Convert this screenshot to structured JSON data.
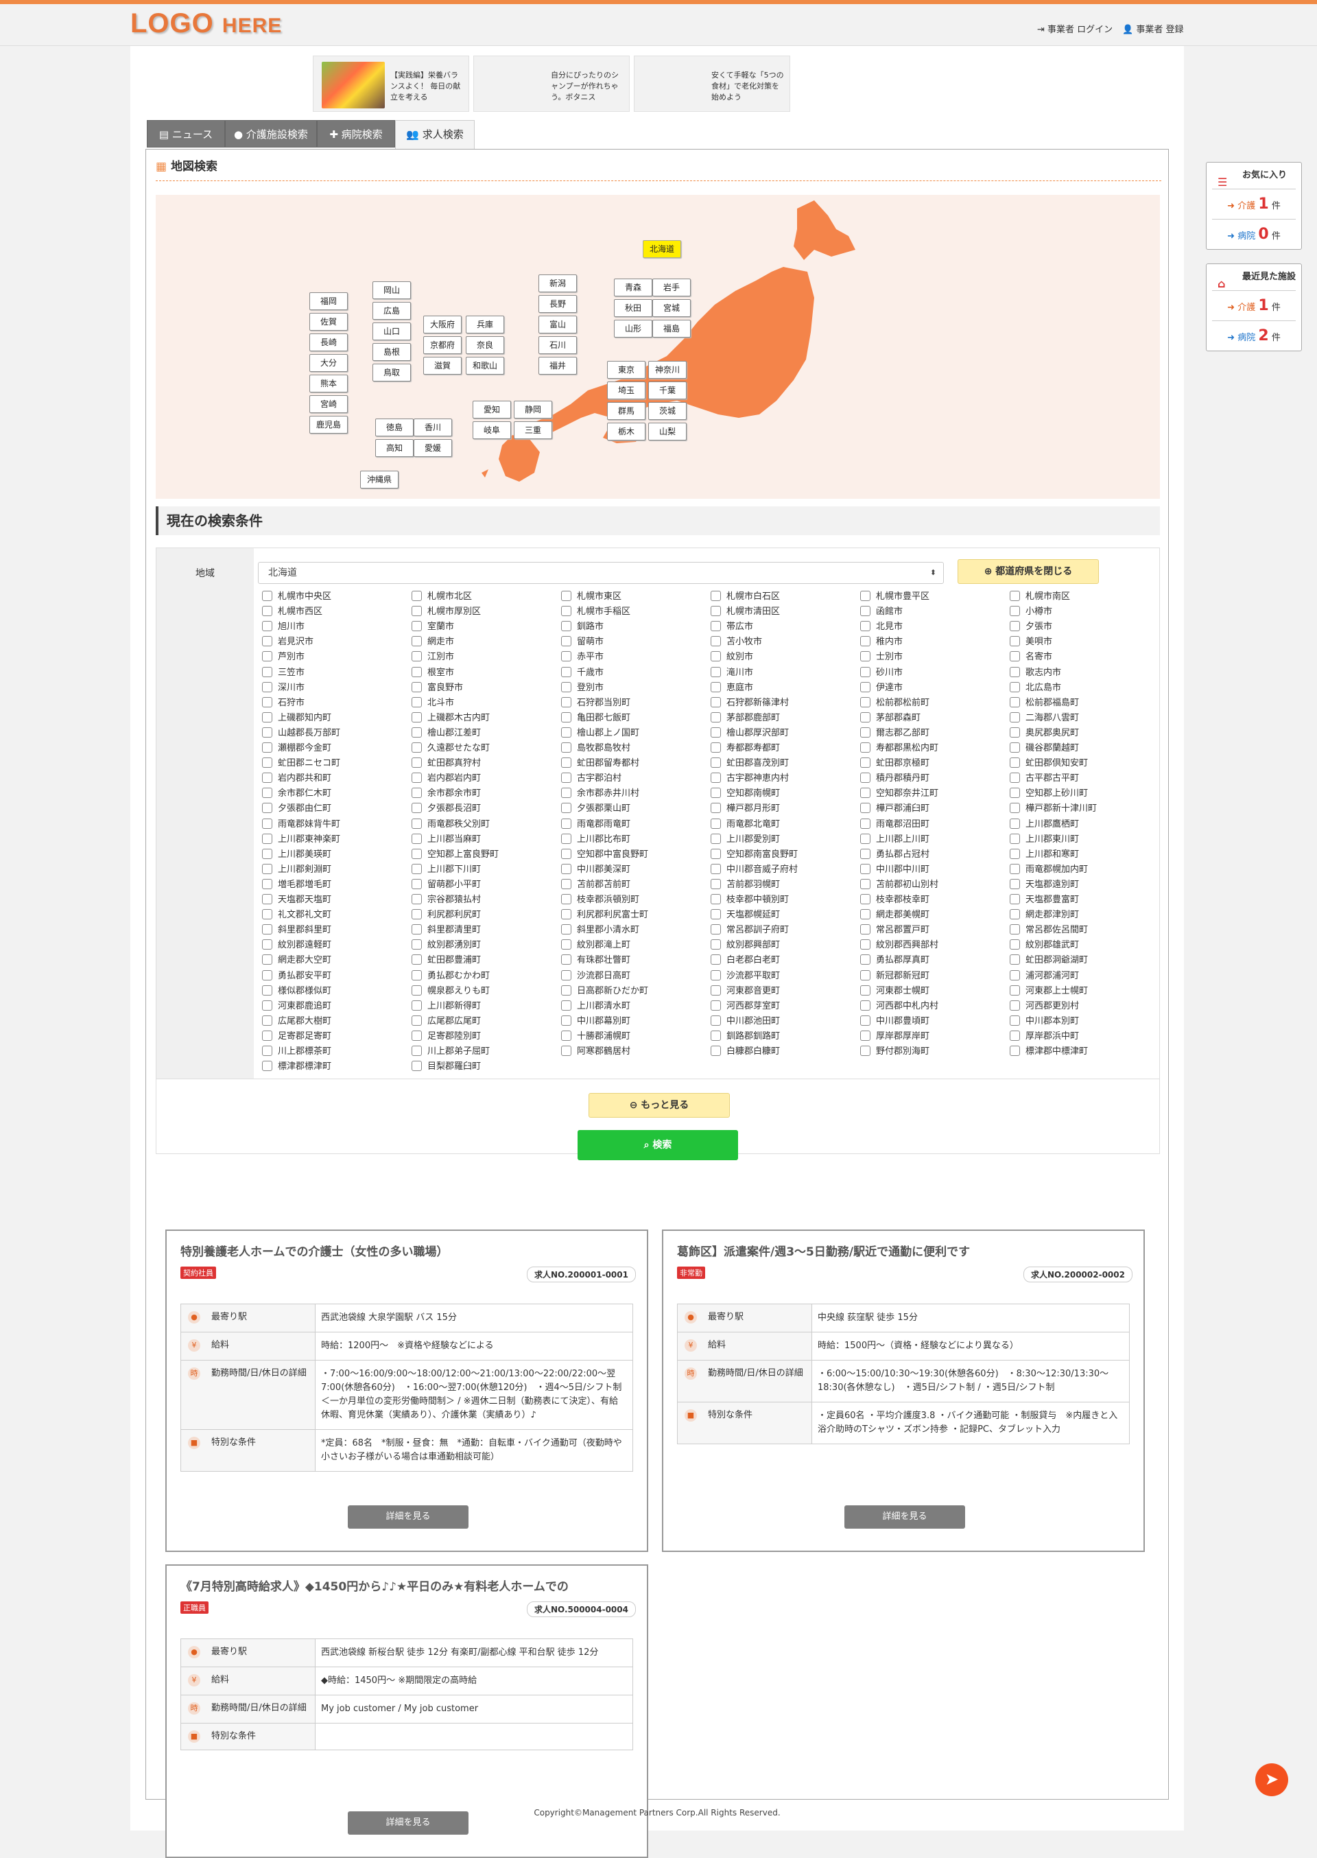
{
  "header": {
    "logo_main": "LOGO",
    "logo_sub": "HERE",
    "login": "事業者 ログイン",
    "register": "事業者 登録"
  },
  "ads": [
    {
      "text": "【実践編】栄養バランスよく！ 毎日の献立を考える"
    },
    {
      "text": "自分にぴったりのシャンプーが作れちゃう。ボタニス"
    },
    {
      "text": "安くて手軽な「5つの食材」で老化対策を始めよう"
    }
  ],
  "tabs": [
    {
      "label": "ニュース"
    },
    {
      "label": "介護施設検索"
    },
    {
      "label": "病院検索"
    },
    {
      "label": "求人検索"
    }
  ],
  "map": {
    "heading": "地図検索",
    "prefs": [
      "北海道",
      "青森",
      "岩手",
      "秋田",
      "宮城",
      "山形",
      "福島",
      "新潟",
      "長野",
      "富山",
      "石川",
      "福井",
      "東京",
      "神奈川",
      "埼玉",
      "千葉",
      "群馬",
      "茨城",
      "栃木",
      "山梨",
      "愛知",
      "静岡",
      "岐阜",
      "三重",
      "大阪府",
      "兵庫",
      "京都府",
      "奈良",
      "滋賀",
      "和歌山",
      "岡山",
      "広島",
      "山口",
      "島根",
      "鳥取",
      "徳島",
      "香川",
      "高知",
      "愛媛",
      "福岡",
      "佐賀",
      "長崎",
      "大分",
      "熊本",
      "宮崎",
      "鹿児島",
      "沖縄県"
    ]
  },
  "conditions": {
    "heading": "現在の検索条件",
    "area_label": "地域",
    "selected": "北海道",
    "close_btn": "都道府県を閉じる",
    "more_btn": "もっと見る",
    "search_btn": "検索",
    "cities": [
      "札幌市中央区",
      "札幌市北区",
      "札幌市東区",
      "札幌市白石区",
      "札幌市豊平区",
      "札幌市南区",
      "札幌市西区",
      "札幌市厚別区",
      "札幌市手稲区",
      "札幌市清田区",
      "函館市",
      "小樽市",
      "旭川市",
      "室蘭市",
      "釧路市",
      "帯広市",
      "北見市",
      "夕張市",
      "岩見沢市",
      "網走市",
      "留萌市",
      "苫小牧市",
      "稚内市",
      "美唄市",
      "芦別市",
      "江別市",
      "赤平市",
      "紋別市",
      "士別市",
      "名寄市",
      "三笠市",
      "根室市",
      "千歳市",
      "滝川市",
      "砂川市",
      "歌志内市",
      "深川市",
      "富良野市",
      "登別市",
      "恵庭市",
      "伊達市",
      "北広島市",
      "石狩市",
      "北斗市",
      "石狩郡当別町",
      "石狩郡新篠津村",
      "松前郡松前町",
      "松前郡福島町",
      "上磯郡知内町",
      "上磯郡木古内町",
      "亀田郡七飯町",
      "茅部郡鹿部町",
      "茅部郡森町",
      "二海郡八雲町",
      "山越郡長万部町",
      "檜山郡江差町",
      "檜山郡上ノ国町",
      "檜山郡厚沢部町",
      "爾志郡乙部町",
      "奥尻郡奥尻町",
      "瀬棚郡今金町",
      "久遠郡せたな町",
      "島牧郡島牧村",
      "寿都郡寿都町",
      "寿都郡黒松内町",
      "磯谷郡蘭越町",
      "虻田郡ニセコ町",
      "虻田郡真狩村",
      "虻田郡留寿都村",
      "虻田郡喜茂別町",
      "虻田郡京極町",
      "虻田郡倶知安町",
      "岩内郡共和町",
      "岩内郡岩内町",
      "古宇郡泊村",
      "古宇郡神恵内村",
      "積丹郡積丹町",
      "古平郡古平町",
      "余市郡仁木町",
      "余市郡余市町",
      "余市郡赤井川村",
      "空知郡南幌町",
      "空知郡奈井江町",
      "空知郡上砂川町",
      "夕張郡由仁町",
      "夕張郡長沼町",
      "夕張郡栗山町",
      "樺戸郡月形町",
      "樺戸郡浦臼町",
      "樺戸郡新十津川町",
      "雨竜郡妹背牛町",
      "雨竜郡秩父別町",
      "雨竜郡雨竜町",
      "雨竜郡北竜町",
      "雨竜郡沼田町",
      "上川郡鷹栖町",
      "上川郡東神楽町",
      "上川郡当麻町",
      "上川郡比布町",
      "上川郡愛別町",
      "上川郡上川町",
      "上川郡東川町",
      "上川郡美瑛町",
      "空知郡上富良野町",
      "空知郡中富良野町",
      "空知郡南富良野町",
      "勇払郡占冠村",
      "上川郡和寒町",
      "上川郡剣淵町",
      "上川郡下川町",
      "中川郡美深町",
      "中川郡音威子府村",
      "中川郡中川町",
      "雨竜郡幌加内町",
      "増毛郡増毛町",
      "留萌郡小平町",
      "苫前郡苫前町",
      "苫前郡羽幌町",
      "苫前郡初山別村",
      "天塩郡遠別町",
      "天塩郡天塩町",
      "宗谷郡猿払村",
      "枝幸郡浜頓別町",
      "枝幸郡中頓別町",
      "枝幸郡枝幸町",
      "天塩郡豊富町",
      "礼文郡礼文町",
      "利尻郡利尻町",
      "利尻郡利尻富士町",
      "天塩郡幌延町",
      "網走郡美幌町",
      "網走郡津別町",
      "斜里郡斜里町",
      "斜里郡清里町",
      "斜里郡小清水町",
      "常呂郡訓子府町",
      "常呂郡置戸町",
      "常呂郡佐呂間町",
      "紋別郡遠軽町",
      "紋別郡湧別町",
      "紋別郡滝上町",
      "紋別郡興部町",
      "紋別郡西興部村",
      "紋別郡雄武町",
      "網走郡大空町",
      "虻田郡豊浦町",
      "有珠郡壮瞥町",
      "白老郡白老町",
      "勇払郡厚真町",
      "虻田郡洞爺湖町",
      "勇払郡安平町",
      "勇払郡むかわ町",
      "沙流郡日高町",
      "沙流郡平取町",
      "新冠郡新冠町",
      "浦河郡浦河町",
      "様似郡様似町",
      "幌泉郡えりも町",
      "日高郡新ひだか町",
      "河東郡音更町",
      "河東郡士幌町",
      "河東郡上士幌町",
      "河東郡鹿追町",
      "上川郡新得町",
      "上川郡清水町",
      "河西郡芽室町",
      "河西郡中札内村",
      "河西郡更別村",
      "広尾郡大樹町",
      "広尾郡広尾町",
      "中川郡幕別町",
      "中川郡池田町",
      "中川郡豊頃町",
      "中川郡本別町",
      "足寄郡足寄町",
      "足寄郡陸別町",
      "十勝郡浦幌町",
      "釧路郡釧路町",
      "厚岸郡厚岸町",
      "厚岸郡浜中町",
      "川上郡標茶町",
      "川上郡弟子屈町",
      "阿寒郡鶴居村",
      "白糠郡白糠町",
      "野付郡別海町",
      "標津郡中標津町",
      "標津郡標津町",
      "目梨郡羅臼町"
    ]
  },
  "jobs": [
    {
      "title": "特別養護老人ホームでの介護士（女性の多い職場）",
      "badge": "契約社員",
      "badge_color": "#dd3333",
      "no": "求人NO.200001-0001",
      "rows": [
        {
          "k": "最寄り駅",
          "icon": "pin-icon",
          "v": "西武池袋線 大泉学園駅 バス 15分"
        },
        {
          "k": "給料",
          "icon": "yen-icon",
          "v": "時給：1200円～　※資格や経験などによる"
        },
        {
          "k": "勤務時間/日/休日の詳細",
          "icon": "clock-icon",
          "v": "・7:00～16:00/9:00～18:00/12:00～21:00/13:00～22:00/22:00～翌7:00(休憩各60分)　・16:00～翌7:00(休憩120分)　・週4～5日/シフト制　＜一か月単位の変形労働時間制＞ / ※週休二日制（勤務表にて決定）、有給休暇、育児休業（実績あり）、介護休業（実績あり）♪"
        },
        {
          "k": "特別な条件",
          "icon": "briefcase-icon",
          "v": "*定員：68名　*制服・昼食：無　*通勤：自転車・バイク通勤可（夜勤時や小さいお子様がいる場合は車通勤相談可能）"
        }
      ],
      "detail": "詳細を見る"
    },
    {
      "title": "葛飾区】派遣案件/週3～5日勤務/駅近で通勤に便利です",
      "badge": "非常勤",
      "badge_color": "#dd3333",
      "no": "求人NO.200002-0002",
      "rows": [
        {
          "k": "最寄り駅",
          "icon": "pin-icon",
          "v": "中央線 荻窪駅 徒歩 15分"
        },
        {
          "k": "給料",
          "icon": "yen-icon",
          "v": "時給：1500円～（資格・経験などにより異なる）"
        },
        {
          "k": "勤務時間/日/休日の詳細",
          "icon": "clock-icon",
          "v": "・6:00～15:00/10:30～19:30(休憩各60分)　・8:30～12:30/13:30～18:30(各休憩なし)　・週5日/シフト制 / ・週5日/シフト制"
        },
        {
          "k": "特別な条件",
          "icon": "briefcase-icon",
          "v": "・定員60名 ・平均介護度3.8 ・バイク通勤可能 ・制服貸与　※内履きと入浴介助時のTシャツ・ズボン持参 ・記録PC、タブレット入力"
        }
      ],
      "detail": "詳細を見る"
    },
    {
      "title": "《7月特別高時給求人》◆1450円から♪♪★平日のみ★有料老人ホームでの",
      "badge": "正職員",
      "badge_color": "#dd3333",
      "no": "求人NO.500004-0004",
      "rows": [
        {
          "k": "最寄り駅",
          "icon": "pin-icon",
          "v": "西武池袋線 新桜台駅 徒歩 12分 有楽町/副都心線 平和台駅 徒歩 12分"
        },
        {
          "k": "給料",
          "icon": "yen-icon",
          "v": "◆時給：1450円～ ※期間限定の高時給"
        },
        {
          "k": "勤務時間/日/休日の詳細",
          "icon": "clock-icon",
          "v": "My job customer / My job customer"
        },
        {
          "k": "特別な条件",
          "icon": "briefcase-icon",
          "v": ""
        }
      ],
      "detail": "詳細を見る"
    }
  ],
  "sidebar": {
    "fav": {
      "title": "お気に入り",
      "kaigo_label": "介護",
      "kaigo_count": "1",
      "byoin_label": "病院",
      "byoin_count": "0",
      "unit": "件"
    },
    "recent": {
      "title": "最近見た施設",
      "kaigo_label": "介護",
      "kaigo_count": "1",
      "byoin_label": "病院",
      "byoin_count": "2",
      "unit": "件"
    }
  },
  "footer": "Copyright©Management Partners Corp.All Rights Reserved.",
  "colors": {
    "accent": "#f08a45",
    "map_land": "#f4844a",
    "search_green": "#22c23a"
  }
}
